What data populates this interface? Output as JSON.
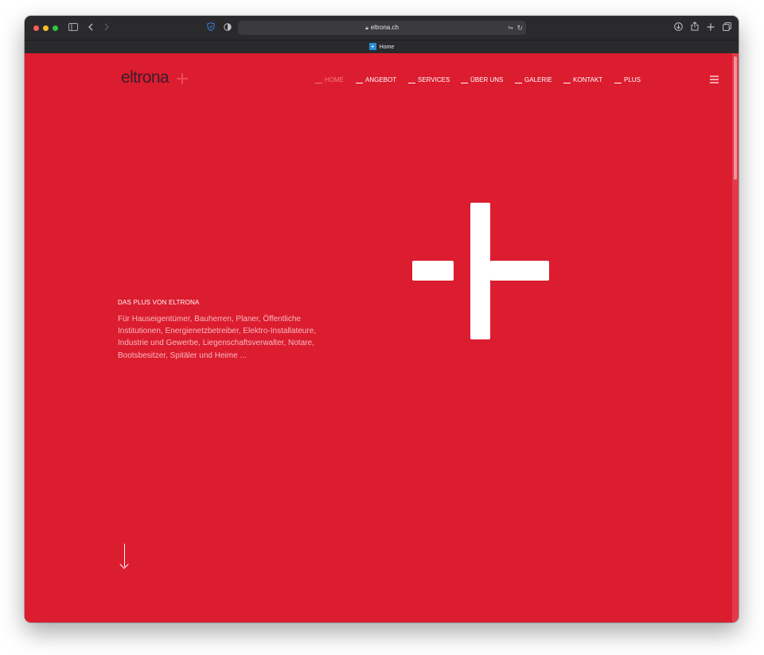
{
  "browser": {
    "url": "eltrona.ch",
    "tab_title": "Home",
    "icons": {
      "sidebar": "sidebar-icon",
      "back": "chevron-left-icon",
      "forward": "chevron-right-icon",
      "shield": "shield-icon",
      "privacy": "privacy-icon",
      "lock": "lock-icon",
      "translate": "translate-icon",
      "reload": "reload-icon",
      "download": "download-icon",
      "share": "share-icon",
      "new_tab": "plus-icon",
      "tabs": "tabs-overview-icon"
    }
  },
  "site": {
    "logo": "eltrona",
    "nav": [
      {
        "label": "HOME",
        "active": true
      },
      {
        "label": "ANGEBOT",
        "active": false
      },
      {
        "label": "SERVICES",
        "active": false
      },
      {
        "label": "ÜBER UNS",
        "active": false
      },
      {
        "label": "GALERIE",
        "active": false
      },
      {
        "label": "KONTAKT",
        "active": false
      },
      {
        "label": "PLUS",
        "active": false
      }
    ],
    "intro": {
      "title": "DAS PLUS VON ELTRONA",
      "text": "Für Hauseigentümer, Bauherren, Planer, Öffentliche Institutionen, Energienetzbetreiber, Elektro-Installateure, Industrie und Gewerbe, Liegenschaftsverwalter, Notare, Bootsbesitzer, Spitäler und Heime ..."
    },
    "colors": {
      "brand_red": "#dc1c2f",
      "logo_text": "#3a1d2c",
      "logo_plus": "#f04756",
      "nav_active": "#f47b86",
      "white": "#ffffff"
    }
  }
}
